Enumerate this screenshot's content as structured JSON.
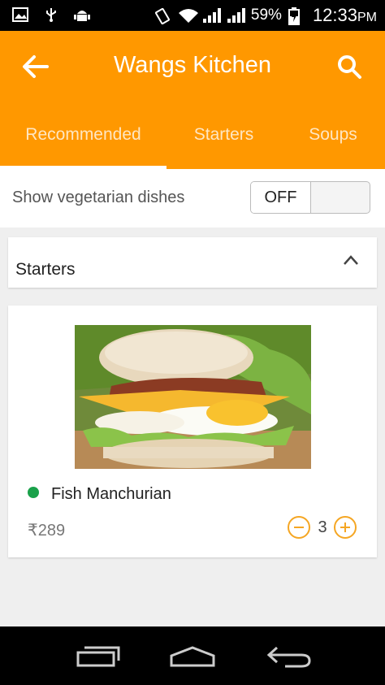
{
  "status_bar": {
    "battery": "59%",
    "time": "12:33",
    "time_suffix": "PM",
    "icons": [
      "gallery-icon",
      "usb-icon",
      "android-icon",
      "vibrate-icon",
      "wifi-icon",
      "signal-icon",
      "signal-icon",
      "battery-charging-icon"
    ]
  },
  "header": {
    "title": "Wangs Kitchen",
    "back_icon": "arrow-left-icon",
    "search_icon": "search-icon",
    "background": "#ff9800"
  },
  "tabs": [
    {
      "label": "Recommended",
      "selected": true
    },
    {
      "label": "Starters",
      "selected": false
    },
    {
      "label": "Soups",
      "selected": false
    }
  ],
  "veg_filter": {
    "label": "Show vegetarian dishes",
    "toggle_label": "OFF"
  },
  "section": {
    "title": "Starters",
    "icon": "chevron-up-icon"
  },
  "dish": {
    "name": "Fish Manchurian",
    "currency": "₹",
    "price": "289",
    "quantity": "3",
    "veg_dot_color": "#1aa14a",
    "image": "sandwich-photo"
  },
  "colors": {
    "accent": "#ff9800",
    "stepper": "#f5a623"
  },
  "nav_bar": {
    "icons": [
      "recents-icon",
      "home-icon",
      "back-icon"
    ]
  }
}
